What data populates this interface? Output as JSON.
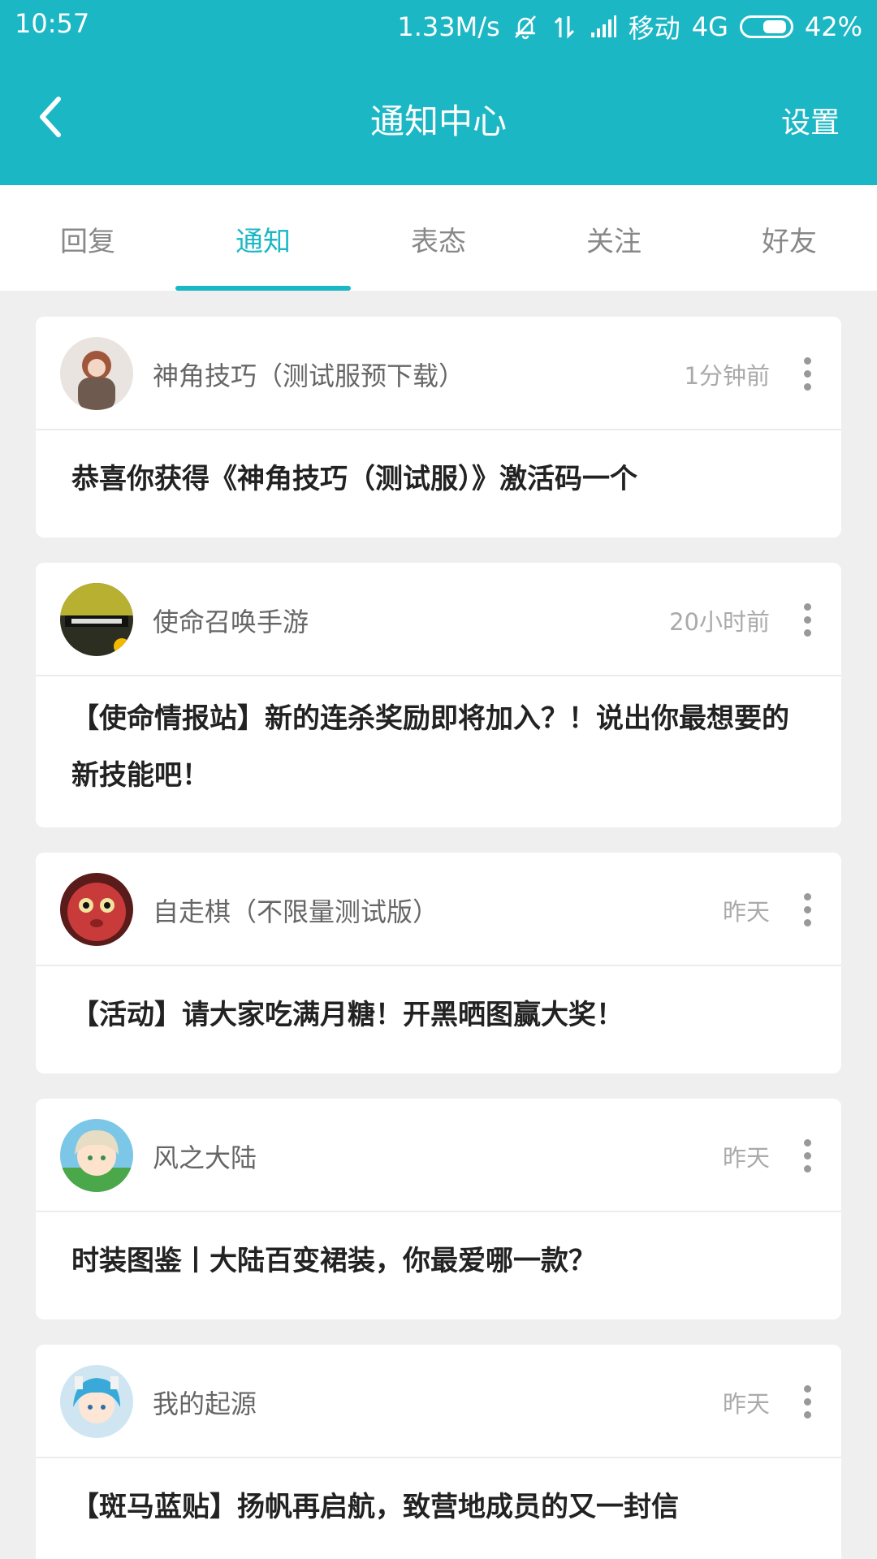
{
  "status": {
    "time": "10:57",
    "speed": "1.33M/s",
    "carrier": "移动",
    "network": "4G",
    "battery": "42%"
  },
  "header": {
    "title": "通知中心",
    "settings_label": "设置"
  },
  "tabs": [
    {
      "label": "回复"
    },
    {
      "label": "通知"
    },
    {
      "label": "表态"
    },
    {
      "label": "关注"
    },
    {
      "label": "好友"
    }
  ],
  "active_tab": "通知",
  "notifications": [
    {
      "name": "神角技巧（测试服预下载）",
      "time": "1分钟前",
      "message": "恭喜你获得《神角技巧（测试服）》激活码一个"
    },
    {
      "name": "使命召唤手游",
      "time": "20小时前",
      "message": "【使命情报站】新的连杀奖励即将加入？！说出你最想要的新技能吧！"
    },
    {
      "name": "自走棋（不限量测试版）",
      "time": "昨天",
      "message": "【活动】请大家吃满月糖！开黑晒图赢大奖！"
    },
    {
      "name": "风之大陆",
      "time": "昨天",
      "message": "时装图鉴丨大陆百变裙装，你最爱哪一款？"
    },
    {
      "name": "我的起源",
      "time": "昨天",
      "message": "【斑马蓝贴】扬帆再启航，致营地成员的又一封信"
    }
  ],
  "colors": {
    "accent": "#1cb7c5",
    "background": "#efefef"
  }
}
